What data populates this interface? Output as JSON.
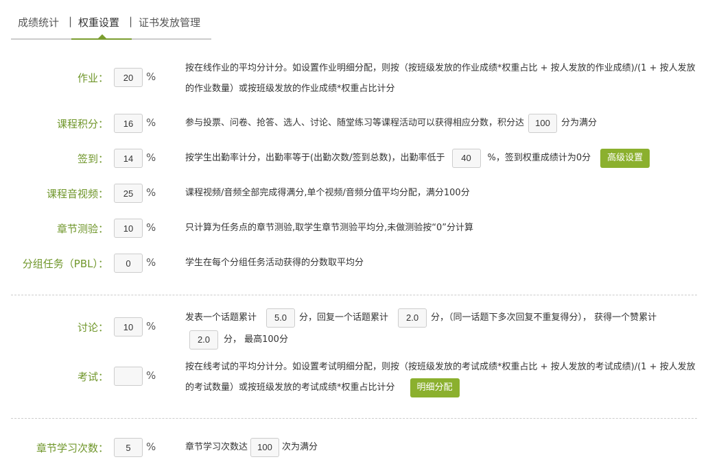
{
  "tabs": [
    "成绩统计",
    "权重设置",
    "证书发放管理"
  ],
  "tab_separator": "|",
  "percent": "%",
  "rows": [
    {
      "label": "作业：",
      "value": "20",
      "desc": "按在线作业的平均分计分。如设置作业明细分配，则按（按班级发放的作业成绩*权重占比 + 按人发放的作业成绩)/(1 + 按人发放的作业数量）或按班级发放的作业成绩*权重占比计分"
    },
    {
      "label": "课程积分：",
      "value": "16",
      "desc_a": "参与投票、问卷、抢答、选人、讨论、随堂练习等课程活动可以获得相应分数，积分达",
      "full": "100",
      "desc_b": "分为满分"
    },
    {
      "label": "签到：",
      "value": "14",
      "desc_a": "按学生出勤率计分，出勤率等于(出勤次数/签到总数)，出勤率低于",
      "rate": "40",
      "desc_b": "%，签到权重成绩计为0分",
      "button": "高级设置"
    },
    {
      "label": "课程音视频：",
      "value": "25",
      "desc": "课程视频/音频全部完成得满分,单个视频/音频分值平均分配，满分100分"
    },
    {
      "label": "章节测验：",
      "value": "10",
      "desc": "只计算为任务点的章节测验,取学生章节测验平均分,未做测验按“0”分计算"
    },
    {
      "label": "分组任务（PBL）：",
      "value": "0",
      "desc": "学生在每个分组任务活动获得的分数取平均分"
    },
    {
      "label": "讨论：",
      "value": "10",
      "d1": "发表一个话题累计",
      "v1": "5.0",
      "d2": "分，回复一个话题累计",
      "v2": "2.0",
      "d3": "分，（同一话题下多次回复不重复得分），  获得一个赞累计",
      "v3": "2.0",
      "d4": "分，  最高100分"
    },
    {
      "label": "考试：",
      "value": "",
      "desc": "按在线考试的平均分计分。如设置考试明细分配，则按（按班级发放的考试成绩*权重占比 + 按人发放的考试成绩)/(1 + 按人发放的考试数量）或按班级发放的考试成绩*权重占比计分",
      "button": "明细分配"
    },
    {
      "label": "章节学习次数：",
      "value": "5",
      "desc_a": "章节学习次数达",
      "full": "100",
      "desc_b": "次为满分"
    }
  ]
}
